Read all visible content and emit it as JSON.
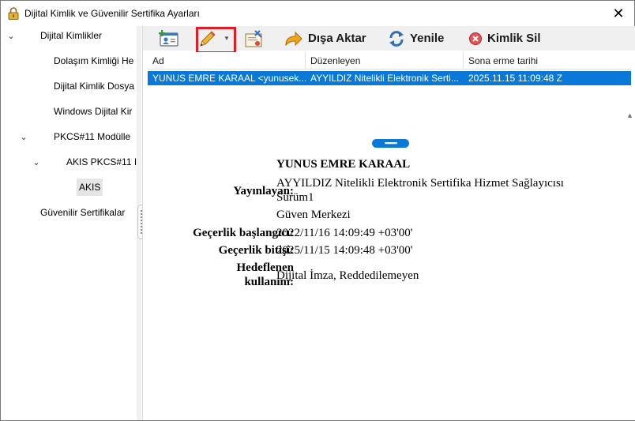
{
  "window": {
    "title": "Dijital Kimlik ve Güvenilir Sertifika Ayarları",
    "close_glyph": "✕"
  },
  "tree": {
    "expand_glyph": "⌄",
    "items": [
      {
        "label": "Dijital Kimlikler"
      },
      {
        "label": "Dolaşım Kimliği He"
      },
      {
        "label": "Dijital Kimlik Dosya"
      },
      {
        "label": "Windows Dijital Kir"
      },
      {
        "label": "PKCS#11 Modülle"
      },
      {
        "label": "AKIS PKCS#11 I"
      },
      {
        "label": "AKIS"
      },
      {
        "label": "Güvenilir Sertifikalar"
      }
    ]
  },
  "toolbar": {
    "add_icon": "add-id-icon",
    "edit_icon": "pencil-icon",
    "edit_caret": "▼",
    "props_icon": "certificate-icon",
    "export_label": "Dışa Aktar",
    "refresh_label": "Yenile",
    "delete_label": "Kimlik Sil"
  },
  "table": {
    "columns": [
      "Ad",
      "Düzenleyen",
      "Sona erme tarihi"
    ],
    "rows": [
      [
        "YUNUS EMRE KARAAL <yunusek...",
        "AYYILDIZ Nitelikli Elektronik Serti...",
        "2025.11.15 11:09:48 Z"
      ]
    ]
  },
  "scroll_arrow": "▲",
  "handle_glyph": "▪▪▪▪▪▪▪",
  "details": {
    "name": "YUNUS EMRE KARAAL",
    "issuer_label": "Yayınlayan:",
    "issuer_line1": "AYYILDIZ Nitelikli Elektronik Sertifika Hizmet Sağlayıcısı",
    "issuer_line2": "Sürüm1",
    "issuer_line3": "Güven Merkezi",
    "valid_from_label": "Geçerlik başlangıcı:",
    "valid_from": "2022/11/16 14:09:49 +03'00'",
    "valid_to_label": "Geçerlik bitişi:",
    "valid_to": "2025/11/15 14:09:48 +03'00'",
    "usage_label_1": "Hedeflenen",
    "usage_label_2": "kullanım:",
    "usage": "Dijital İmza, Reddedilemeyen"
  },
  "colors": {
    "accent": "#0a78d7",
    "highlight": "#e21c23",
    "toolbar_bg": "#f0f0f0"
  }
}
